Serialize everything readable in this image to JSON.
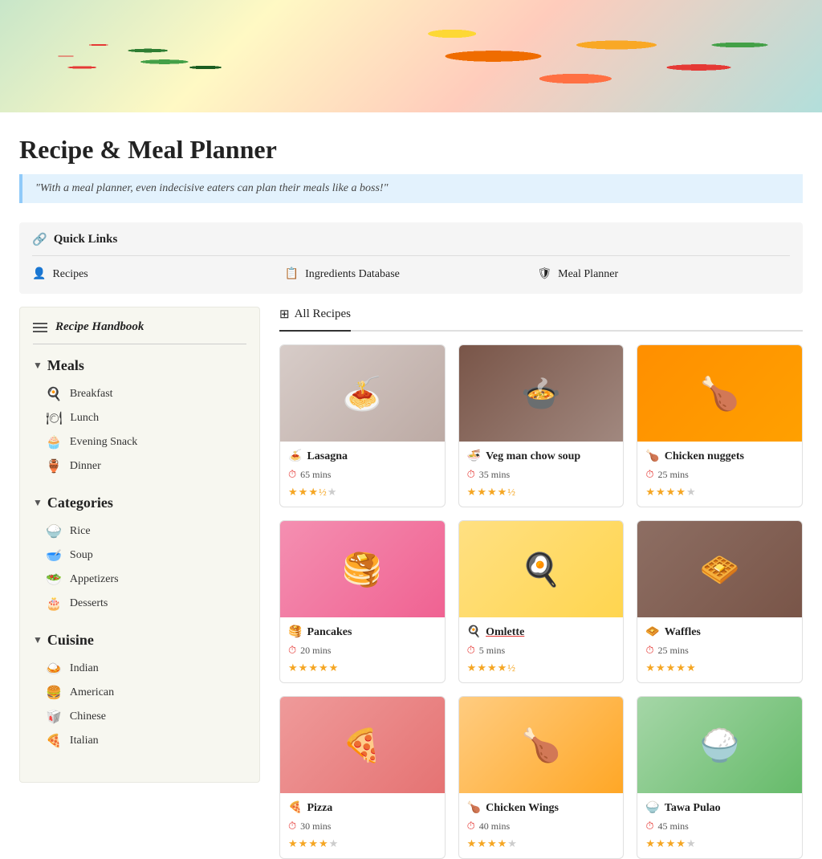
{
  "hero": {
    "alt": "Food background image"
  },
  "page": {
    "title": "Recipe & Meal Planner",
    "quote": "\"With a meal planner, even indecisive eaters can plan their meals like a boss!\""
  },
  "quickLinks": {
    "title": "Quick Links",
    "items": [
      {
        "id": "recipes",
        "label": "Recipes",
        "icon": "👤"
      },
      {
        "id": "ingredients",
        "label": "Ingredients Database",
        "icon": "📋"
      },
      {
        "id": "planner",
        "label": "Meal Planner",
        "icon": "🛡"
      }
    ]
  },
  "sidebar": {
    "header": "Recipe Handbook",
    "sections": [
      {
        "id": "meals",
        "title": "Meals",
        "items": [
          {
            "id": "breakfast",
            "label": "Breakfast",
            "icon": "🍳"
          },
          {
            "id": "lunch",
            "label": "Lunch",
            "icon": "🍽"
          },
          {
            "id": "evening-snack",
            "label": "Evening Snack",
            "icon": "🧁"
          },
          {
            "id": "dinner",
            "label": "Dinner",
            "icon": "🏺"
          }
        ]
      },
      {
        "id": "categories",
        "title": "Categories",
        "items": [
          {
            "id": "rice",
            "label": "Rice",
            "icon": "🍚"
          },
          {
            "id": "soup",
            "label": "Soup",
            "icon": "🥣"
          },
          {
            "id": "appetizers",
            "label": "Appetizers",
            "icon": "🥗"
          },
          {
            "id": "desserts",
            "label": "Desserts",
            "icon": "🎂"
          }
        ]
      },
      {
        "id": "cuisine",
        "title": "Cuisine",
        "items": [
          {
            "id": "indian",
            "label": "Indian",
            "icon": "🇮🇳"
          },
          {
            "id": "american",
            "label": "American",
            "icon": "🍔"
          },
          {
            "id": "chinese",
            "label": "Chinese",
            "icon": "🥡"
          },
          {
            "id": "italian",
            "label": "Italian",
            "icon": "🍕"
          }
        ]
      }
    ]
  },
  "recipes": {
    "tabLabel": "All Recipes",
    "tabIcon": "⊞",
    "cards": [
      {
        "id": "lasagna",
        "name": "Lasagna",
        "icon": "🍝",
        "time": "65 mins",
        "rating": 3.5,
        "maxRating": 5,
        "link": false,
        "imgClass": "img-lasagna",
        "imgEmoji": "🍝"
      },
      {
        "id": "veg-man-chow-soup",
        "name": "Veg man chow soup",
        "icon": "🍜",
        "time": "35 mins",
        "rating": 4.5,
        "maxRating": 5,
        "link": false,
        "imgClass": "img-soup",
        "imgEmoji": "🍲"
      },
      {
        "id": "chicken-nuggets",
        "name": "Chicken nuggets",
        "icon": "🍗",
        "time": "25 mins",
        "rating": 4,
        "maxRating": 5,
        "link": false,
        "imgClass": "img-nuggets",
        "imgEmoji": "🍗"
      },
      {
        "id": "pancakes",
        "name": "Pancakes",
        "icon": "🥞",
        "time": "20 mins",
        "rating": 5,
        "maxRating": 5,
        "link": false,
        "imgClass": "img-pancakes",
        "imgEmoji": "🥞"
      },
      {
        "id": "omlette",
        "name": "Omlette",
        "icon": "🍳",
        "time": "5 mins",
        "rating": 4.5,
        "maxRating": 5,
        "link": true,
        "imgClass": "img-omlette",
        "imgEmoji": "🍳"
      },
      {
        "id": "waffles",
        "name": "Waffles",
        "icon": "🧇",
        "time": "25 mins",
        "rating": 5,
        "maxRating": 5,
        "link": false,
        "imgClass": "img-waffles",
        "imgEmoji": "🧇"
      },
      {
        "id": "pizza",
        "name": "Pizza",
        "icon": "🍕",
        "time": "30 mins",
        "rating": 4,
        "maxRating": 5,
        "link": false,
        "imgClass": "img-pizza",
        "imgEmoji": "🍕"
      },
      {
        "id": "chicken-wings",
        "name": "Chicken Wings",
        "icon": "🍗",
        "time": "40 mins",
        "rating": 4,
        "maxRating": 5,
        "link": false,
        "imgClass": "img-chicken-wings",
        "imgEmoji": "🍗"
      },
      {
        "id": "tawa-pulao",
        "name": "Tawa Pulao",
        "icon": "🍚",
        "time": "45 mins",
        "rating": 4,
        "maxRating": 5,
        "link": false,
        "imgClass": "img-tawa-pulao",
        "imgEmoji": "🍚"
      }
    ]
  }
}
